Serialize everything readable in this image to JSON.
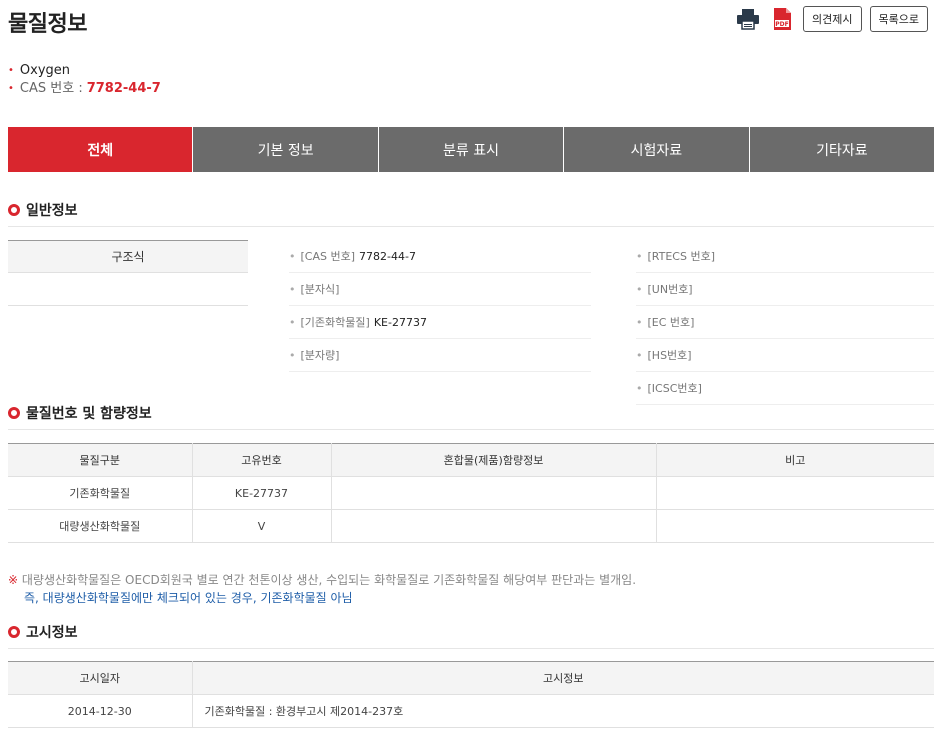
{
  "page": {
    "title": "물질정보"
  },
  "toolbar": {
    "print_icon": "printer-icon",
    "pdf_icon": "pdf-icon",
    "opinion_label": "의견제시",
    "list_label": "목록으로"
  },
  "substance": {
    "name": "Oxygen",
    "cas_label": "CAS 번호 : ",
    "cas_value": "7782-44-7"
  },
  "tabs": [
    {
      "label": "전체",
      "active": true
    },
    {
      "label": "기본 정보",
      "active": false
    },
    {
      "label": "분류 표시",
      "active": false
    },
    {
      "label": "시험자료",
      "active": false
    },
    {
      "label": "기타자료",
      "active": false
    }
  ],
  "general": {
    "heading": "일반정보",
    "structure_label": "구조식",
    "left": [
      {
        "label": "[CAS 번호]",
        "value": "7782-44-7"
      },
      {
        "label": "[분자식]",
        "value": ""
      },
      {
        "label": "[기존화학물질]",
        "value": "KE-27737"
      },
      {
        "label": "[분자량]",
        "value": ""
      }
    ],
    "right": [
      {
        "label": "[RTECS 번호]",
        "value": ""
      },
      {
        "label": "[UN번호]",
        "value": ""
      },
      {
        "label": "[EC 번호]",
        "value": ""
      },
      {
        "label": "[HS번호]",
        "value": ""
      },
      {
        "label": "[ICSC번호]",
        "value": ""
      }
    ]
  },
  "content": {
    "heading": "물질번호 및 함량정보",
    "headers": [
      "물질구분",
      "고유번호",
      "혼합물(제품)함량정보",
      "비고"
    ],
    "rows": [
      [
        "기존화학물질",
        "KE-27737",
        "",
        ""
      ],
      [
        "대량생산화학물질",
        "V",
        "",
        ""
      ]
    ]
  },
  "note": {
    "mark": "※",
    "line1": " 대량생산화학물질은 OECD회원국 별로 연간 천톤이상 생산, 수입되는 화학물질로 기존화학물질 해당여부 판단과는 별개임.",
    "line2": "즉, 대량생산화학물질에만 체크되어 있는 경우, 기존화학물질 아님"
  },
  "notice": {
    "heading": "고시정보",
    "headers": [
      "고시일자",
      "고시정보"
    ],
    "rows": [
      [
        "2014-12-30",
        "기존화학물질 : 환경부고시 제2014-237호"
      ]
    ]
  },
  "colors": {
    "accent": "#d9262e",
    "tab_inactive": "#6b6b6b",
    "link_blue": "#1f5ea8"
  }
}
